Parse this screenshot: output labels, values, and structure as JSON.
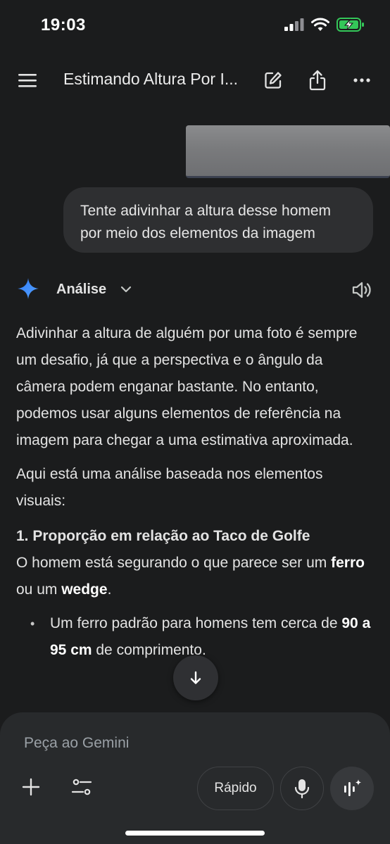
{
  "status": {
    "time": "19:03"
  },
  "header": {
    "title": "Estimando Altura Por I..."
  },
  "user_message": {
    "text": "Tente adivinhar a altura desse homem por meio dos elementos da imagem"
  },
  "response": {
    "model_label": "Análise",
    "paragraph_1": "Adivinhar a altura de alguém por uma foto é sempre um desafio, já que a perspectiva e o ângulo da câmera podem enganar bastante. No entanto, podemos usar alguns elementos de referência na imagem para chegar a uma estimativa aproximada.",
    "paragraph_2": "Aqui está uma análise baseada nos elementos visuais:",
    "section_1_heading": "1. Proporção em relação ao Taco de Golfe",
    "section_1_text_a": "O homem está segurando o que parece ser um ",
    "section_1_bold_a": "ferro",
    "section_1_text_b": " ou um ",
    "section_1_bold_b": "wedge",
    "section_1_text_c": ".",
    "bullet_1_text_a": "Um ferro padrão para homens tem cerca de ",
    "bullet_1_bold": "90 a 95 cm",
    "bullet_1_text_b": " de comprimento."
  },
  "composer": {
    "placeholder": "Peça ao Gemini",
    "mode_label": "Rápido"
  },
  "icons": {
    "menu": "hamburger-menu-icon",
    "edit": "edit-icon",
    "share": "share-icon",
    "more": "more-horizontal-icon",
    "gemini": "gemini-sparkle-icon",
    "chevron": "chevron-down-icon",
    "speaker": "speaker-icon",
    "scroll": "arrow-down-icon",
    "add": "plus-icon",
    "tools": "tools-sliders-icon",
    "mic": "microphone-icon",
    "live": "live-audio-icon"
  },
  "colors": {
    "background": "#1b1c1d",
    "bubble": "#2e2f31",
    "panel": "#282a2c",
    "battery": "#34c759",
    "gemini_accent": "#4c8df6"
  }
}
